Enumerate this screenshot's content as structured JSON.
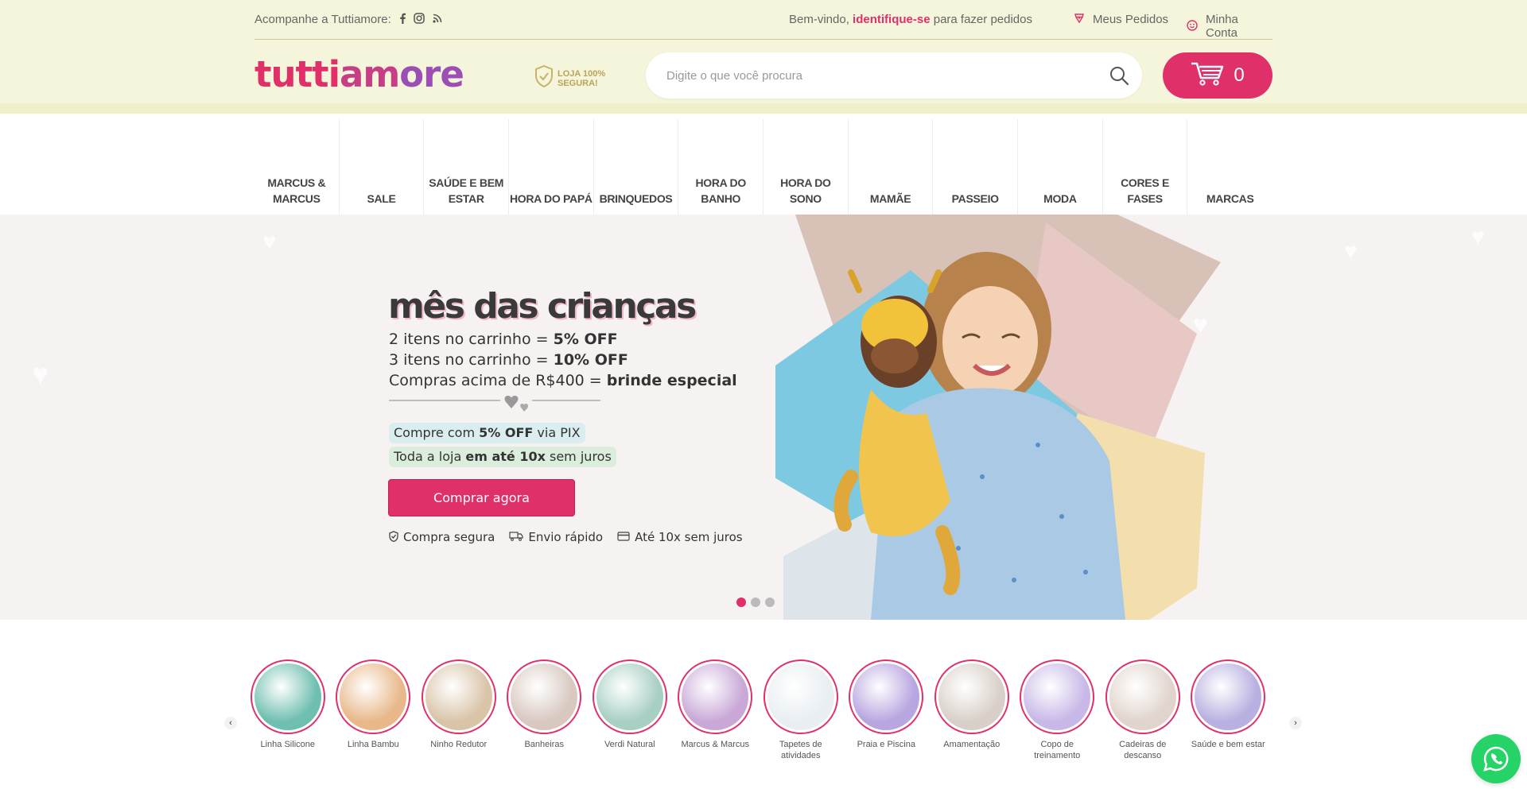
{
  "topbar": {
    "follow_label": "Acompanhe a Tuttiamore:",
    "social_icons": [
      "facebook-icon",
      "instagram-icon",
      "blog-icon"
    ],
    "welcome_prefix": "Bem-vindo,",
    "welcome_link": "identifique-se",
    "welcome_suffix": "para fazer pedidos",
    "orders_label": "Meus Pedidos",
    "account_label": "Minha Conta"
  },
  "header": {
    "logo": {
      "part1": "tutti",
      "part2": "am",
      "part3": "ore"
    },
    "secure_line1": "LOJA 100%",
    "secure_line2": "SEGURA!",
    "search_placeholder": "Digite o que você procura",
    "cart_count": "0"
  },
  "nav": {
    "items": [
      {
        "label": "MARCUS & MARCUS"
      },
      {
        "label": "SALE"
      },
      {
        "label": "SAÚDE E BEM ESTAR"
      },
      {
        "label": "HORA DO PAPÁ"
      },
      {
        "label": "BRINQUEDOS"
      },
      {
        "label": "HORA DO BANHO"
      },
      {
        "label": "HORA DO SONO"
      },
      {
        "label": "MAMÃE"
      },
      {
        "label": "PASSEIO"
      },
      {
        "label": "MODA"
      },
      {
        "label": "CORES E FASES"
      },
      {
        "label": "MARCAS"
      }
    ]
  },
  "hero": {
    "title": "mês das crianças",
    "promo1_text": "2 itens no carrinho =",
    "promo1_bold": "5% OFF",
    "promo2_text": "3 itens no carrinho =",
    "promo2_bold": "10% OFF",
    "promo3_text": "Compras acima de R$400 =",
    "promo3_bold": "brinde especial",
    "pix_prefix": "Compre com",
    "pix_bold": "5% OFF",
    "pix_suffix": "via PIX",
    "install_prefix": "Toda a loja",
    "install_bold": "em até 10x",
    "install_suffix": "sem juros",
    "cta": "Comprar agora",
    "badges": [
      {
        "icon": "shield-icon",
        "label": "Compra segura"
      },
      {
        "icon": "truck-icon",
        "label": "Envio rápido"
      },
      {
        "icon": "card-icon",
        "label": "Até 10x sem juros"
      }
    ],
    "slides": 3,
    "active_slide": 1
  },
  "categories": [
    {
      "label": "Linha Silicone",
      "color": "#6fbfb0"
    },
    {
      "label": "Linha Bambu",
      "color": "#e8b88a"
    },
    {
      "label": "Ninho Redutor",
      "color": "#d9c4a8"
    },
    {
      "label": "Banheiras",
      "color": "#d8c8c0"
    },
    {
      "label": "Verdi Natural",
      "color": "#a8cfc4"
    },
    {
      "label": "Marcus & Marcus",
      "color": "#c9a8d8"
    },
    {
      "label": "Tapetes de atividades",
      "color": "#e8eef2"
    },
    {
      "label": "Praia e Piscina",
      "color": "#b8a6e0"
    },
    {
      "label": "Amamentação",
      "color": "#d8d0c8"
    },
    {
      "label": "Copo de treinamento",
      "color": "#c8b8e8"
    },
    {
      "label": "Cadeiras de descanso",
      "color": "#e0d4cc"
    },
    {
      "label": "Saúde e bem estar",
      "color": "#b8b0e0"
    }
  ],
  "colors": {
    "brand_pink": "#e0306a",
    "header_bg": "#f5f5db",
    "whatsapp": "#25d366"
  }
}
